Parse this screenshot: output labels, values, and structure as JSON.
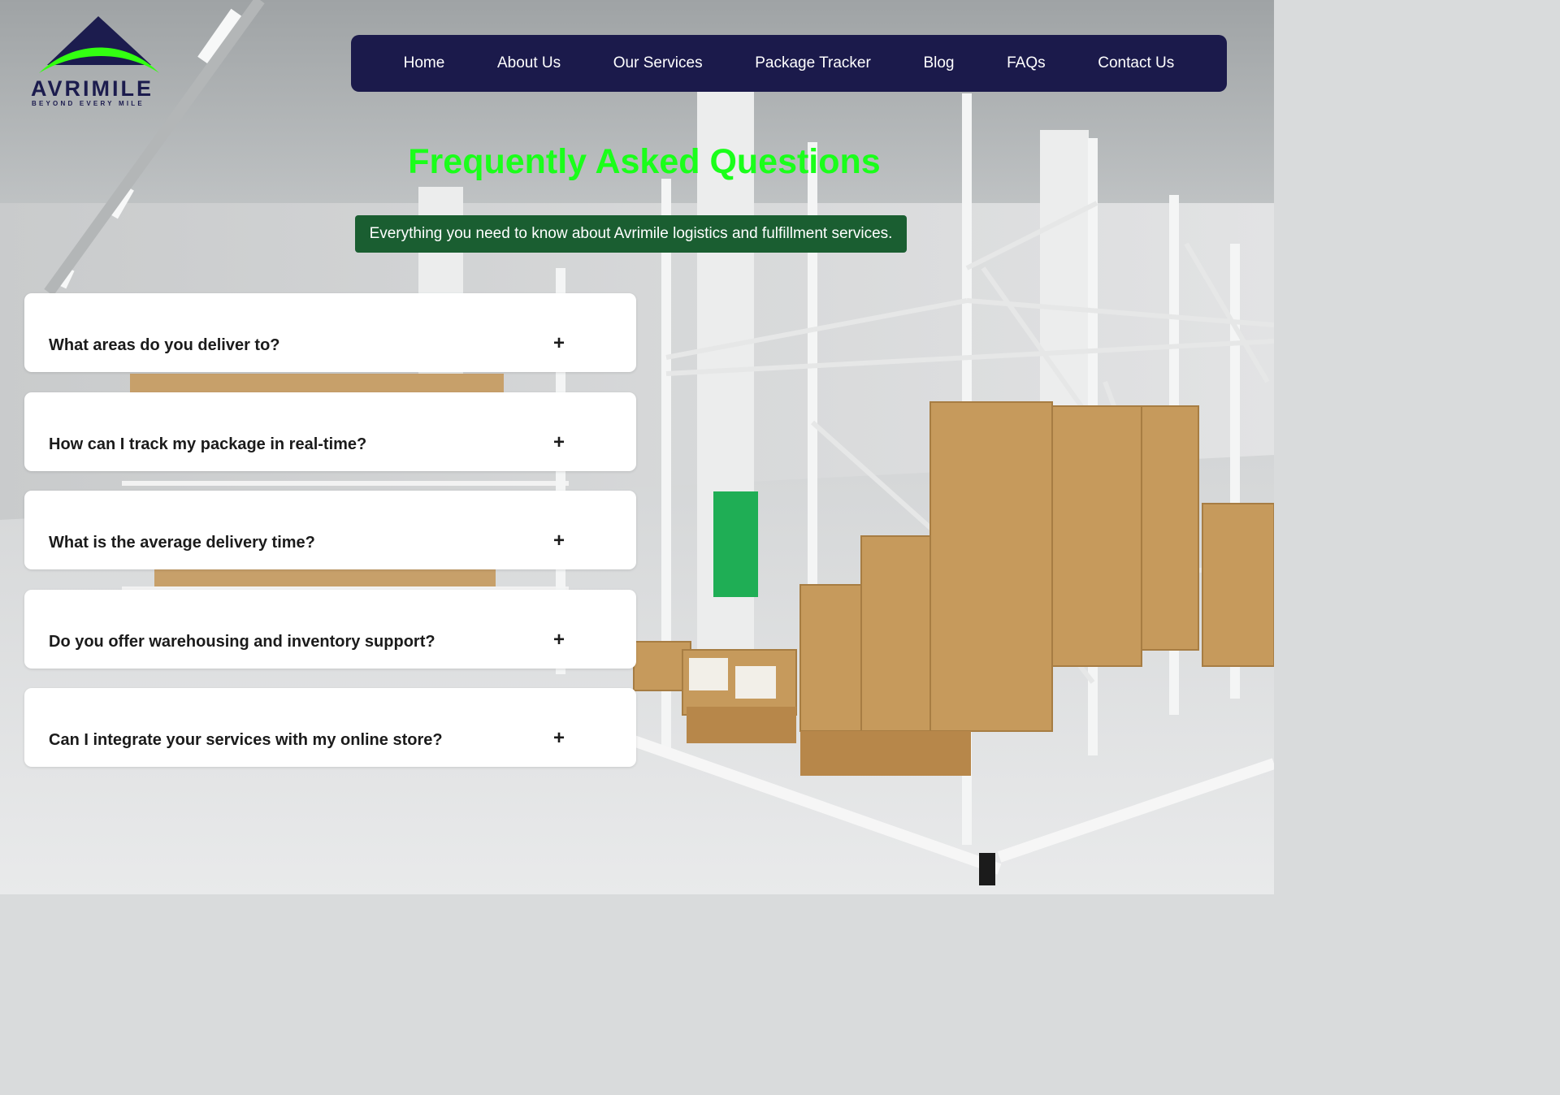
{
  "logo": {
    "name": "AVRIMILE",
    "tagline": "BEYOND EVERY MILE"
  },
  "nav": {
    "items": [
      {
        "label": "Home"
      },
      {
        "label": "About Us"
      },
      {
        "label": "Our Services"
      },
      {
        "label": "Package Tracker"
      },
      {
        "label": "Blog"
      },
      {
        "label": "FAQs"
      },
      {
        "label": "Contact Us"
      }
    ]
  },
  "hero": {
    "title": "Frequently Asked Questions",
    "subtitle": "Everything you need to know about Avrimile logistics and fulfillment services."
  },
  "faq": {
    "items": [
      {
        "question": "What areas do you deliver to?",
        "toggle": "+"
      },
      {
        "question": "How can I track my package in real-time?",
        "toggle": "+"
      },
      {
        "question": "What is the average delivery time?",
        "toggle": "+"
      },
      {
        "question": "Do you offer warehousing and inventory support?",
        "toggle": "+"
      },
      {
        "question": "Can I integrate your services with my online store?",
        "toggle": "+"
      }
    ]
  },
  "colors": {
    "nav_bg": "#1b1a4b",
    "title_green": "#1aff1a",
    "subtitle_bg": "#1a5e31",
    "logo_navy": "#1c1c4e",
    "logo_green": "#33ff11"
  },
  "icons": {
    "faq_toggle": "plus-icon",
    "logo_mark": "mountain-swoosh-icon"
  }
}
